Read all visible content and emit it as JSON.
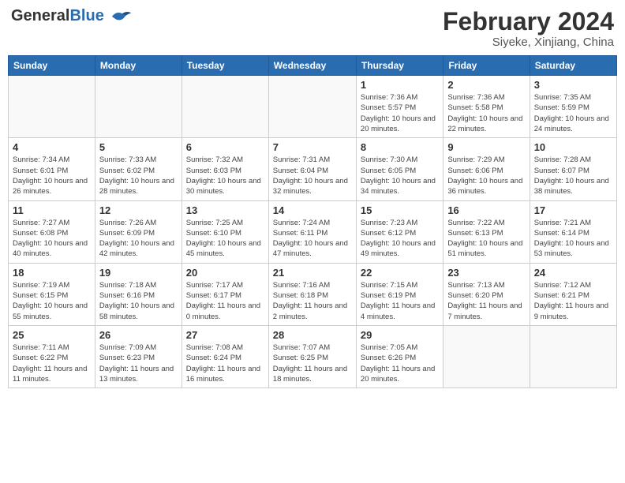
{
  "header": {
    "logo_text_general": "General",
    "logo_text_blue": "Blue",
    "month_year": "February 2024",
    "location": "Siyeke, Xinjiang, China"
  },
  "columns": [
    "Sunday",
    "Monday",
    "Tuesday",
    "Wednesday",
    "Thursday",
    "Friday",
    "Saturday"
  ],
  "weeks": [
    [
      {
        "day": "",
        "info": ""
      },
      {
        "day": "",
        "info": ""
      },
      {
        "day": "",
        "info": ""
      },
      {
        "day": "",
        "info": ""
      },
      {
        "day": "1",
        "info": "Sunrise: 7:36 AM\nSunset: 5:57 PM\nDaylight: 10 hours and 20 minutes."
      },
      {
        "day": "2",
        "info": "Sunrise: 7:36 AM\nSunset: 5:58 PM\nDaylight: 10 hours and 22 minutes."
      },
      {
        "day": "3",
        "info": "Sunrise: 7:35 AM\nSunset: 5:59 PM\nDaylight: 10 hours and 24 minutes."
      }
    ],
    [
      {
        "day": "4",
        "info": "Sunrise: 7:34 AM\nSunset: 6:01 PM\nDaylight: 10 hours and 26 minutes."
      },
      {
        "day": "5",
        "info": "Sunrise: 7:33 AM\nSunset: 6:02 PM\nDaylight: 10 hours and 28 minutes."
      },
      {
        "day": "6",
        "info": "Sunrise: 7:32 AM\nSunset: 6:03 PM\nDaylight: 10 hours and 30 minutes."
      },
      {
        "day": "7",
        "info": "Sunrise: 7:31 AM\nSunset: 6:04 PM\nDaylight: 10 hours and 32 minutes."
      },
      {
        "day": "8",
        "info": "Sunrise: 7:30 AM\nSunset: 6:05 PM\nDaylight: 10 hours and 34 minutes."
      },
      {
        "day": "9",
        "info": "Sunrise: 7:29 AM\nSunset: 6:06 PM\nDaylight: 10 hours and 36 minutes."
      },
      {
        "day": "10",
        "info": "Sunrise: 7:28 AM\nSunset: 6:07 PM\nDaylight: 10 hours and 38 minutes."
      }
    ],
    [
      {
        "day": "11",
        "info": "Sunrise: 7:27 AM\nSunset: 6:08 PM\nDaylight: 10 hours and 40 minutes."
      },
      {
        "day": "12",
        "info": "Sunrise: 7:26 AM\nSunset: 6:09 PM\nDaylight: 10 hours and 42 minutes."
      },
      {
        "day": "13",
        "info": "Sunrise: 7:25 AM\nSunset: 6:10 PM\nDaylight: 10 hours and 45 minutes."
      },
      {
        "day": "14",
        "info": "Sunrise: 7:24 AM\nSunset: 6:11 PM\nDaylight: 10 hours and 47 minutes."
      },
      {
        "day": "15",
        "info": "Sunrise: 7:23 AM\nSunset: 6:12 PM\nDaylight: 10 hours and 49 minutes."
      },
      {
        "day": "16",
        "info": "Sunrise: 7:22 AM\nSunset: 6:13 PM\nDaylight: 10 hours and 51 minutes."
      },
      {
        "day": "17",
        "info": "Sunrise: 7:21 AM\nSunset: 6:14 PM\nDaylight: 10 hours and 53 minutes."
      }
    ],
    [
      {
        "day": "18",
        "info": "Sunrise: 7:19 AM\nSunset: 6:15 PM\nDaylight: 10 hours and 55 minutes."
      },
      {
        "day": "19",
        "info": "Sunrise: 7:18 AM\nSunset: 6:16 PM\nDaylight: 10 hours and 58 minutes."
      },
      {
        "day": "20",
        "info": "Sunrise: 7:17 AM\nSunset: 6:17 PM\nDaylight: 11 hours and 0 minutes."
      },
      {
        "day": "21",
        "info": "Sunrise: 7:16 AM\nSunset: 6:18 PM\nDaylight: 11 hours and 2 minutes."
      },
      {
        "day": "22",
        "info": "Sunrise: 7:15 AM\nSunset: 6:19 PM\nDaylight: 11 hours and 4 minutes."
      },
      {
        "day": "23",
        "info": "Sunrise: 7:13 AM\nSunset: 6:20 PM\nDaylight: 11 hours and 7 minutes."
      },
      {
        "day": "24",
        "info": "Sunrise: 7:12 AM\nSunset: 6:21 PM\nDaylight: 11 hours and 9 minutes."
      }
    ],
    [
      {
        "day": "25",
        "info": "Sunrise: 7:11 AM\nSunset: 6:22 PM\nDaylight: 11 hours and 11 minutes."
      },
      {
        "day": "26",
        "info": "Sunrise: 7:09 AM\nSunset: 6:23 PM\nDaylight: 11 hours and 13 minutes."
      },
      {
        "day": "27",
        "info": "Sunrise: 7:08 AM\nSunset: 6:24 PM\nDaylight: 11 hours and 16 minutes."
      },
      {
        "day": "28",
        "info": "Sunrise: 7:07 AM\nSunset: 6:25 PM\nDaylight: 11 hours and 18 minutes."
      },
      {
        "day": "29",
        "info": "Sunrise: 7:05 AM\nSunset: 6:26 PM\nDaylight: 11 hours and 20 minutes."
      },
      {
        "day": "",
        "info": ""
      },
      {
        "day": "",
        "info": ""
      }
    ]
  ]
}
